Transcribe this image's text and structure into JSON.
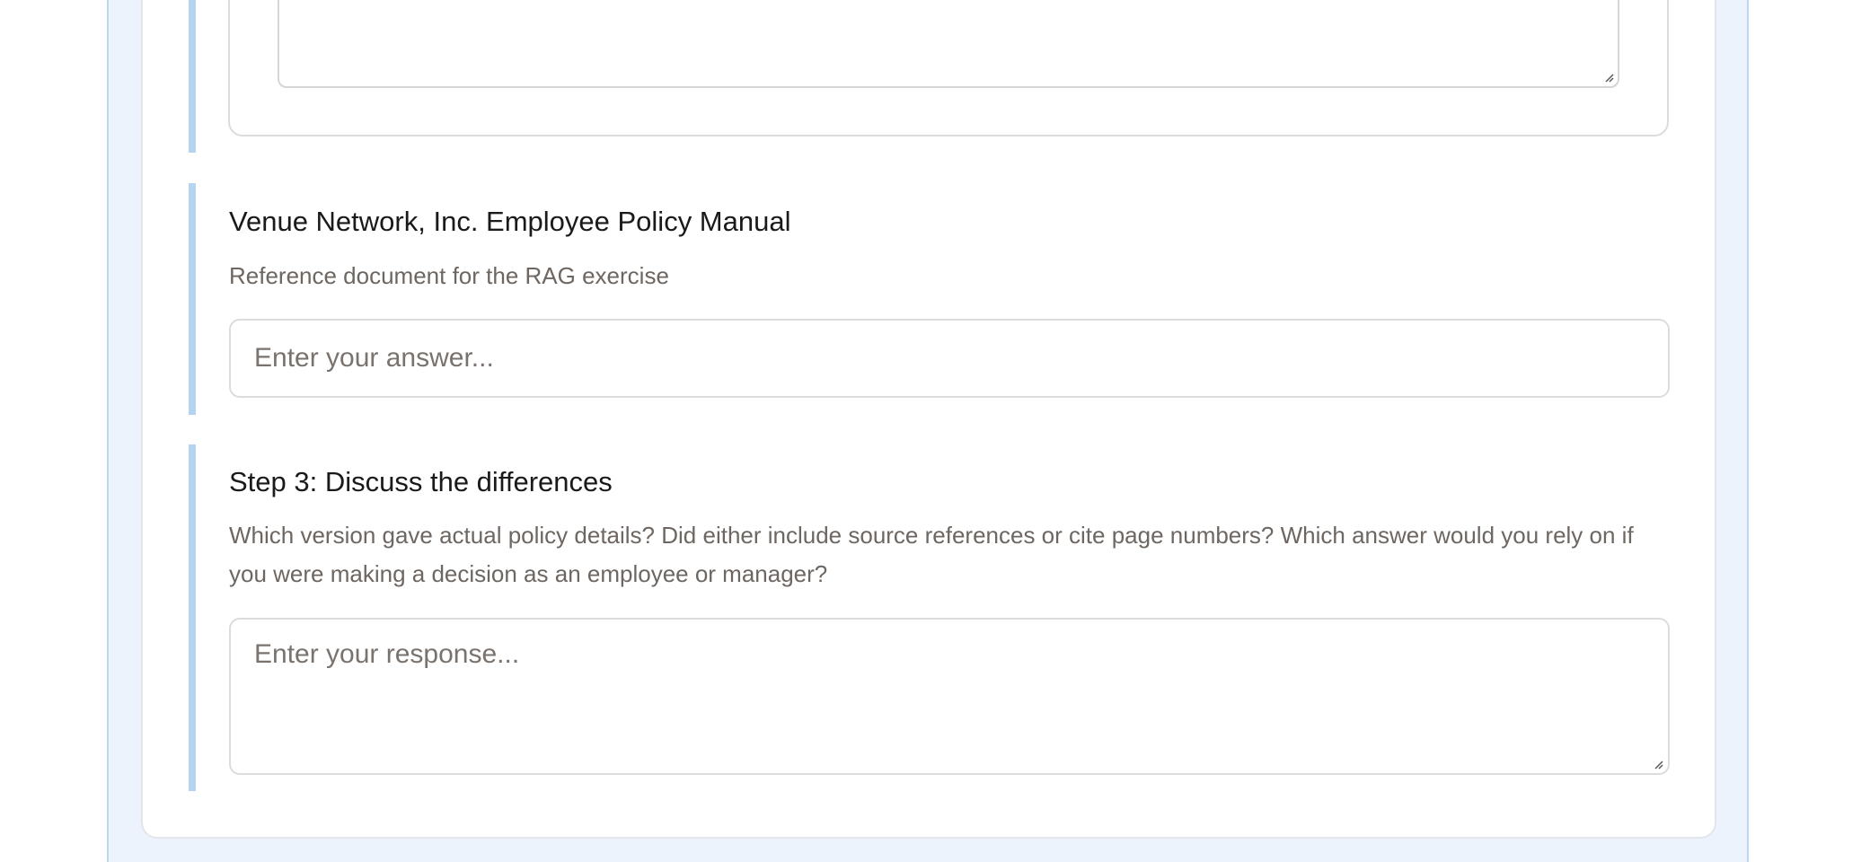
{
  "sections": [
    {
      "title": "Venue Network, Inc. Employee Policy Manual",
      "description": "Reference document for the RAG exercise",
      "placeholder": "Enter your answer..."
    },
    {
      "title": "Step 3: Discuss the differences",
      "description": "Which version gave actual policy details? Did either include source references or cite page numbers? Which answer would you rely on if you were making a decision as an employee or manager?",
      "placeholder": "Enter your response..."
    }
  ]
}
